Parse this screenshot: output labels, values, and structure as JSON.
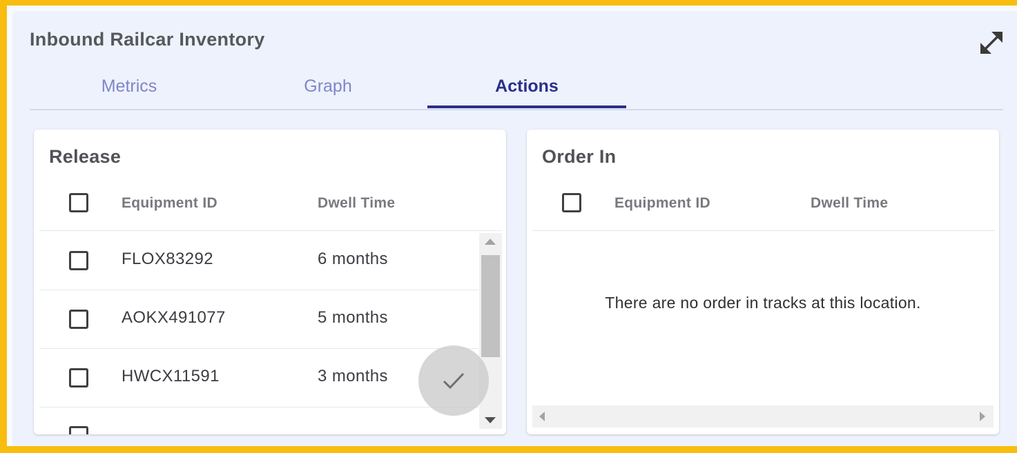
{
  "widget": {
    "title": "Inbound Railcar Inventory"
  },
  "tabs": [
    {
      "label": "Metrics",
      "active": false
    },
    {
      "label": "Graph",
      "active": false
    },
    {
      "label": "Actions",
      "active": true
    }
  ],
  "release": {
    "title": "Release",
    "columns": {
      "equipment_id": "Equipment ID",
      "dwell_time": "Dwell Time"
    },
    "rows": [
      {
        "equipment_id": "FLOX83292",
        "dwell_time": "6 months"
      },
      {
        "equipment_id": "AOKX491077",
        "dwell_time": "5 months"
      },
      {
        "equipment_id": "HWCX11591",
        "dwell_time": "3 months"
      }
    ]
  },
  "order_in": {
    "title": "Order In",
    "columns": {
      "equipment_id": "Equipment ID",
      "dwell_time": "Dwell Time"
    },
    "empty_message": "There are no order in tracks at this location."
  },
  "icons": {
    "expand": "expand-arrows-icon",
    "confirm": "checkmark-icon"
  },
  "colors": {
    "frame_accent": "#f9bd10",
    "tab_active": "#2b2f8c",
    "tab_inactive": "#7f86c7",
    "panel_bg": "#eef2fd"
  }
}
